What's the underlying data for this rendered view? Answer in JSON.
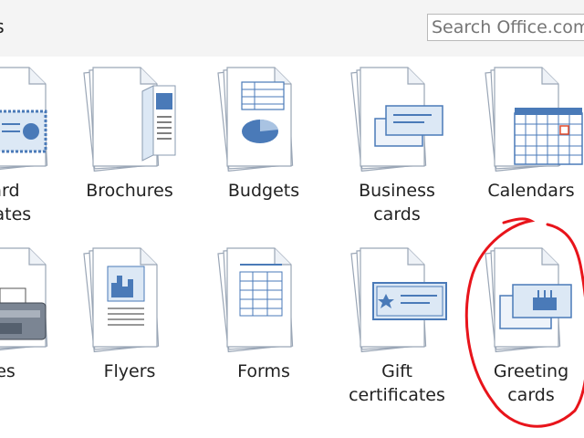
{
  "header": {
    "title": "es",
    "search_placeholder": "Search Office.com"
  },
  "templates": [
    {
      "id": "award-certificates",
      "line1": "ard",
      "line2": "icates",
      "icon": "certificate-icon"
    },
    {
      "id": "brochures",
      "line1": "Brochures",
      "line2": "",
      "icon": "brochure-icon"
    },
    {
      "id": "budgets",
      "line1": "Budgets",
      "line2": "",
      "icon": "budget-icon"
    },
    {
      "id": "business-cards",
      "line1": "Business",
      "line2": "cards",
      "icon": "business-card-icon"
    },
    {
      "id": "calendars",
      "line1": "Calendars",
      "line2": "",
      "icon": "calendar-icon"
    },
    {
      "id": "faxes",
      "line1": "es",
      "line2": "",
      "icon": "fax-icon"
    },
    {
      "id": "flyers",
      "line1": "Flyers",
      "line2": "",
      "icon": "flyer-icon"
    },
    {
      "id": "forms",
      "line1": "Forms",
      "line2": "",
      "icon": "form-icon"
    },
    {
      "id": "gift-certificates",
      "line1": "Gift",
      "line2": "certificates",
      "icon": "gift-certificate-icon"
    },
    {
      "id": "greeting-cards",
      "line1": "Greeting",
      "line2": "cards",
      "icon": "greeting-card-icon"
    }
  ],
  "colors": {
    "accent_blue": "#4a7ab8",
    "light_blue": "#dce8f5",
    "annotation_red": "#e8141b"
  }
}
